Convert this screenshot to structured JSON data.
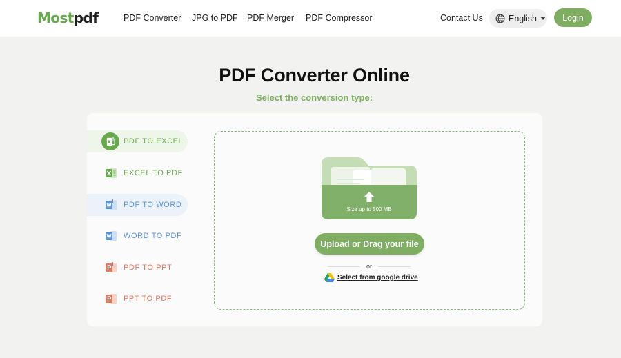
{
  "header": {
    "logo_part1": "Most",
    "logo_part2": "pdf",
    "nav": [
      {
        "label": "PDF Converter"
      },
      {
        "label": "JPG to PDF"
      },
      {
        "label": "PDF Merger"
      },
      {
        "label": "PDF Compressor"
      }
    ],
    "contact_label": "Contact Us",
    "language": "English",
    "login_label": "Login"
  },
  "hero": {
    "title": "PDF Converter Online",
    "subtitle": "Select the conversion type:"
  },
  "conversion_types": [
    {
      "label": "PDF TO EXCEL",
      "icon": "excel-file-icon",
      "selected": true
    },
    {
      "label": "EXCEL TO PDF",
      "icon": "excel-file-icon",
      "selected": false
    },
    {
      "label": "PDF TO WORD",
      "icon": "word-file-icon",
      "selected": false
    },
    {
      "label": "WORD TO PDF",
      "icon": "word-file-icon",
      "selected": false
    },
    {
      "label": "PDF TO PPT",
      "icon": "ppt-file-icon",
      "selected": false
    },
    {
      "label": "PPT TO PDF",
      "icon": "ppt-file-icon",
      "selected": false
    }
  ],
  "upload": {
    "size_limit": "Size up to 500 MB",
    "button_label": "Upload or Drag your file",
    "or_text": "or",
    "google_drive_label": "Select from google drive"
  },
  "colors": {
    "brand_green": "#7fad62",
    "excel_green": "#6aa84f",
    "word_blue": "#5a93d6",
    "ppt_red": "#e0785e",
    "page_background": "#f2f2f1"
  }
}
